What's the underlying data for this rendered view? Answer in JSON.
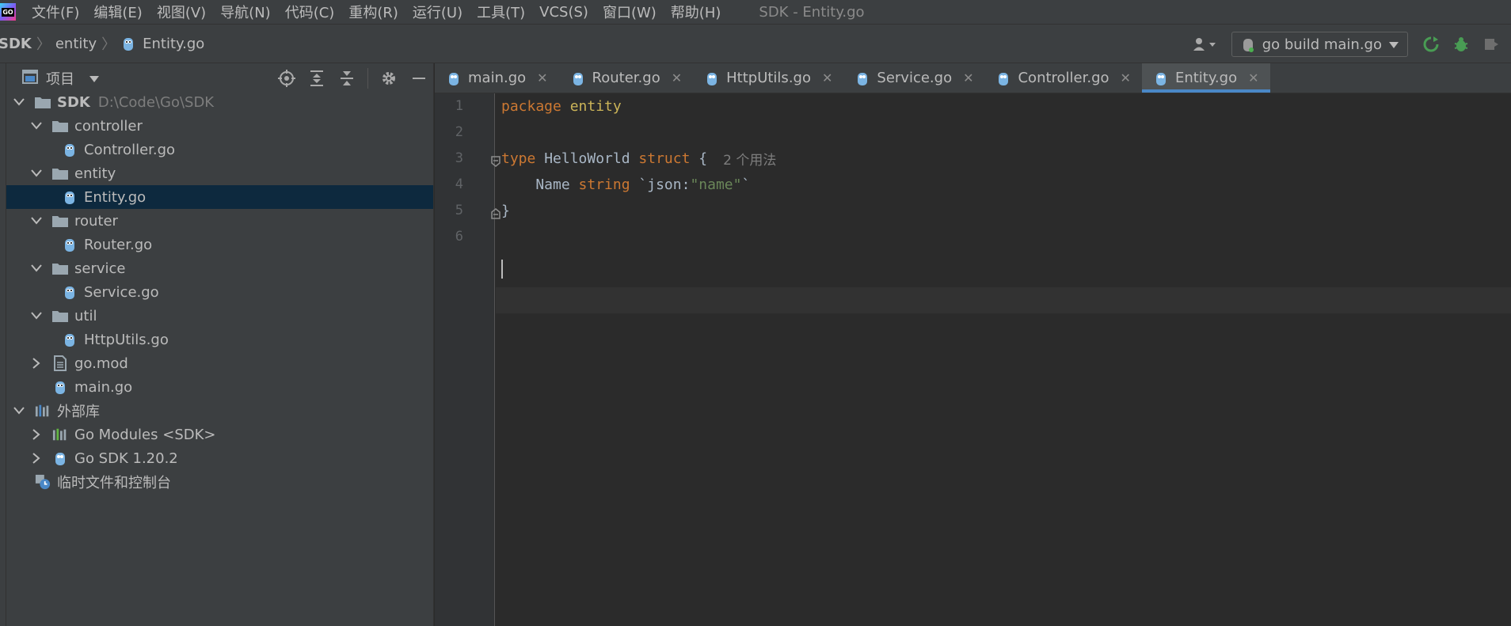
{
  "menu": {
    "items": [
      "文件(F)",
      "编辑(E)",
      "视图(V)",
      "导航(N)",
      "代码(C)",
      "重构(R)",
      "运行(U)",
      "工具(T)",
      "VCS(S)",
      "窗口(W)",
      "帮助(H)"
    ],
    "window_title": "SDK - Entity.go"
  },
  "breadcrumb": {
    "items": [
      "SDK",
      "entity",
      "Entity.go"
    ]
  },
  "run_config": {
    "label": "go build main.go"
  },
  "project_panel": {
    "title": "项目",
    "tree": [
      {
        "label": "SDK",
        "path": "D:\\Code\\Go\\SDK",
        "type": "root-folder",
        "expanded": true
      },
      {
        "label": "controller",
        "type": "folder",
        "expanded": true
      },
      {
        "label": "Controller.go",
        "type": "go-file"
      },
      {
        "label": "entity",
        "type": "folder",
        "expanded": true
      },
      {
        "label": "Entity.go",
        "type": "go-file",
        "selected": true
      },
      {
        "label": "router",
        "type": "folder",
        "expanded": true
      },
      {
        "label": "Router.go",
        "type": "go-file"
      },
      {
        "label": "service",
        "type": "folder",
        "expanded": true
      },
      {
        "label": "Service.go",
        "type": "go-file"
      },
      {
        "label": "util",
        "type": "folder",
        "expanded": true
      },
      {
        "label": "HttpUtils.go",
        "type": "go-file"
      },
      {
        "label": "go.mod",
        "type": "mod-file",
        "expanded": false
      },
      {
        "label": "main.go",
        "type": "go-file"
      },
      {
        "label": "外部库",
        "type": "library",
        "expanded": true
      },
      {
        "label": "Go Modules <SDK>",
        "type": "library",
        "expanded": false
      },
      {
        "label": "Go SDK 1.20.2",
        "type": "go-sdk",
        "expanded": false
      },
      {
        "label": "临时文件和控制台",
        "type": "scratch"
      }
    ]
  },
  "tabs": [
    {
      "label": "main.go",
      "active": false
    },
    {
      "label": "Router.go",
      "active": false
    },
    {
      "label": "HttpUtils.go",
      "active": false
    },
    {
      "label": "Service.go",
      "active": false
    },
    {
      "label": "Controller.go",
      "active": false
    },
    {
      "label": "Entity.go",
      "active": true
    }
  ],
  "editor": {
    "line_numbers": [
      "1",
      "2",
      "3",
      "4",
      "5",
      "6"
    ],
    "code": {
      "l1_kw": "package",
      "l1_name": " entity",
      "l3_kw": "type",
      "l3_name": " HelloWorld ",
      "l3_kw2": "struct",
      "l3_brace": " {",
      "l3_hint": "2 个用法",
      "l4_name": "    Name ",
      "l4_type": "string",
      "l4_tag_open": " `json:",
      "l4_tag_str": "\"name\"",
      "l4_tag_close": "`",
      "l5_brace": "}"
    }
  },
  "colors": {
    "keyword": "#cc7832",
    "string": "#6a8759",
    "text": "#a9b7c6",
    "tab_underline": "#4a88c7",
    "selection": "#0d293e"
  }
}
